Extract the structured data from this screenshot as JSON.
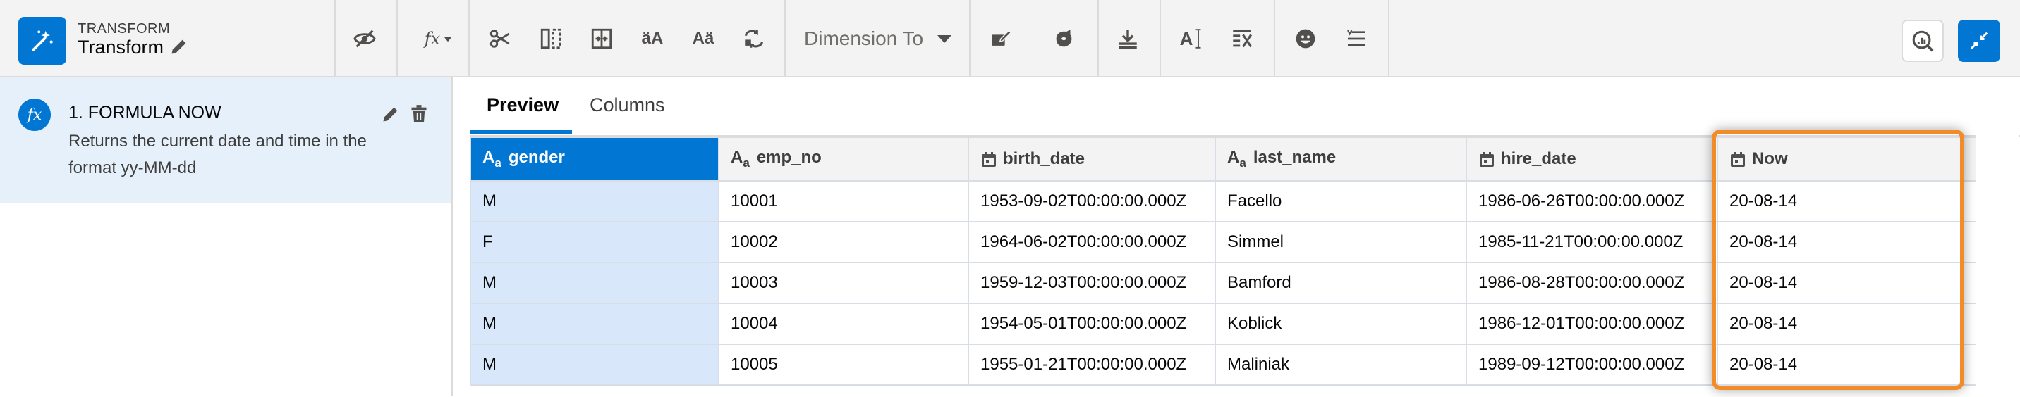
{
  "app": {
    "kicker": "TRANSFORM",
    "title": "Transform",
    "accent": "#0176d3"
  },
  "toolbar": {
    "icons": [
      "hide-icon",
      "formula-icon",
      "split-icon",
      "column-split-icon",
      "flatten-icon",
      "lowercase-icon",
      "uppercase-icon",
      "swap-icon",
      "edit-attributes-icon",
      "sentiment-icon",
      "download-icon",
      "text-cursor-icon",
      "remove-columns-icon",
      "emoji-icon",
      "list-icon"
    ],
    "dimension_select": "Dimension To"
  },
  "step": {
    "title": "1. FORMULA NOW",
    "description": "Returns the current date and time in the format yy-MM-dd"
  },
  "tabs": [
    {
      "label": "Preview",
      "active": true
    },
    {
      "label": "Columns",
      "active": false
    }
  ],
  "grid": {
    "columns": [
      {
        "name": "gender",
        "type": "text"
      },
      {
        "name": "emp_no",
        "type": "text"
      },
      {
        "name": "birth_date",
        "type": "date"
      },
      {
        "name": "last_name",
        "type": "text"
      },
      {
        "name": "hire_date",
        "type": "date"
      },
      {
        "name": "Now",
        "type": "date"
      }
    ],
    "type_text_label": "A",
    "type_text_sub": "a",
    "rows": [
      [
        "M",
        "10001",
        "1953-09-02T00:00:00.000Z",
        "Facello",
        "1986-06-26T00:00:00.000Z",
        "20-08-14"
      ],
      [
        "F",
        "10002",
        "1964-06-02T00:00:00.000Z",
        "Simmel",
        "1985-11-21T00:00:00.000Z",
        "20-08-14"
      ],
      [
        "M",
        "10003",
        "1959-12-03T00:00:00.000Z",
        "Bamford",
        "1986-08-28T00:00:00.000Z",
        "20-08-14"
      ],
      [
        "M",
        "10004",
        "1954-05-01T00:00:00.000Z",
        "Koblick",
        "1986-12-01T00:00:00.000Z",
        "20-08-14"
      ],
      [
        "M",
        "10005",
        "1955-01-21T00:00:00.000Z",
        "Maliniak",
        "1989-09-12T00:00:00.000Z",
        "20-08-14"
      ]
    ]
  },
  "highlight_color": "#f28c28"
}
